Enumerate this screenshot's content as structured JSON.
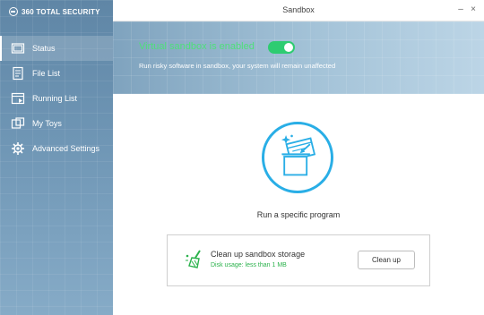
{
  "app": {
    "brand": "360 TOTAL SECURITY",
    "window_title": "Sandbox",
    "minimize_glyph": "–",
    "close_glyph": "×"
  },
  "sidebar": {
    "items": [
      {
        "label": "Status",
        "icon": "status-icon",
        "active": true
      },
      {
        "label": "File List",
        "icon": "file-list-icon",
        "active": false
      },
      {
        "label": "Running List",
        "icon": "running-list-icon",
        "active": false
      },
      {
        "label": "My Toys",
        "icon": "my-toys-icon",
        "active": false
      },
      {
        "label": "Advanced Settings",
        "icon": "gear-icon",
        "active": false
      }
    ]
  },
  "banner": {
    "status": "Virtual sandbox is enabled",
    "toggle_on": true,
    "description": "Run risky software in sandbox, your system will remain unaffected"
  },
  "main": {
    "run_label": "Run a specific program",
    "cleanup": {
      "title": "Clean up sandbox storage",
      "usage": "Disk usage: less than 1 MB",
      "button": "Clean up"
    }
  },
  "colors": {
    "accent": "#29aee6",
    "success": "#2ecc71",
    "sidebar": "#6f96b5"
  }
}
